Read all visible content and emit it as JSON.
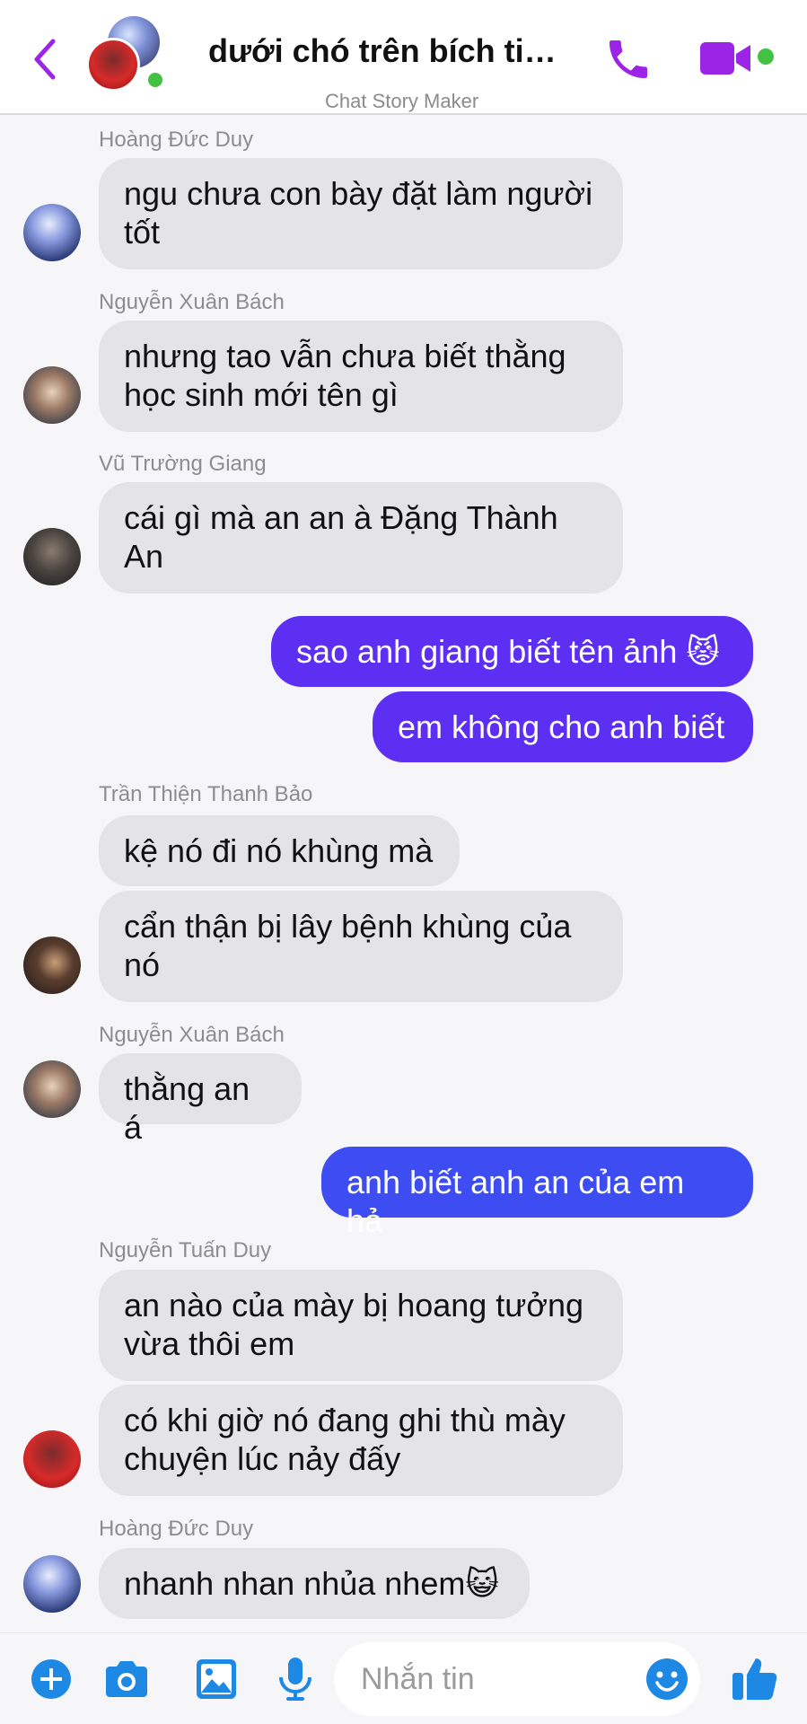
{
  "header": {
    "title": "dưới chó trên bích tiên...",
    "subtitle": "Chat Story Maker"
  },
  "messages": [
    {
      "name": "Hoàng Đức Duy",
      "text": "ngu chưa con bày đặt làm người tốt"
    },
    {
      "name": "Nguyễn Xuân Bách",
      "text": "nhưng tao vẫn chưa biết thằng học sinh mới tên gì"
    },
    {
      "name": "Vũ Trường Giang",
      "text": "cái gì mà an an à Đặng Thành An"
    },
    {
      "text": "sao anh giang biết tên ảnh 😾"
    },
    {
      "text": "em không cho anh biết"
    },
    {
      "name": "Trần Thiện Thanh Bảo",
      "text": "kệ nó đi nó khùng mà"
    },
    {
      "text": "cẩn thận bị lây bệnh khùng của nó"
    },
    {
      "name": "Nguyễn Xuân Bách",
      "text": "thằng an á"
    },
    {
      "text": "anh biết anh an của em hả"
    },
    {
      "name": "Nguyễn Tuấn Duy",
      "text": "an nào của mày bị hoang tưởng vừa thôi em"
    },
    {
      "text": "có khi giờ nó đang ghi thù mày chuyện lúc nảy đấy"
    },
    {
      "name": "Hoàng Đức Duy",
      "text": "nhanh nhan nhủa nhem😺"
    }
  ],
  "composer": {
    "placeholder": "Nhắn tin"
  },
  "colors": {
    "accent": "#9b24e6",
    "outgoing_bubble": "#5d2ff3",
    "outgoing_bubble_alt": "#3d4df2",
    "incoming_bubble": "#e4e4e6",
    "online": "#42c142",
    "bottom_icons": "#1e88e5"
  },
  "icons": {
    "back": "chevron-left-icon",
    "call": "phone-icon",
    "video": "video-camera-icon",
    "add": "plus-circle-icon",
    "camera": "camera-icon",
    "gallery": "image-icon",
    "mic": "microphone-icon",
    "emoji": "smiley-icon",
    "like": "thumbs-up-icon"
  }
}
